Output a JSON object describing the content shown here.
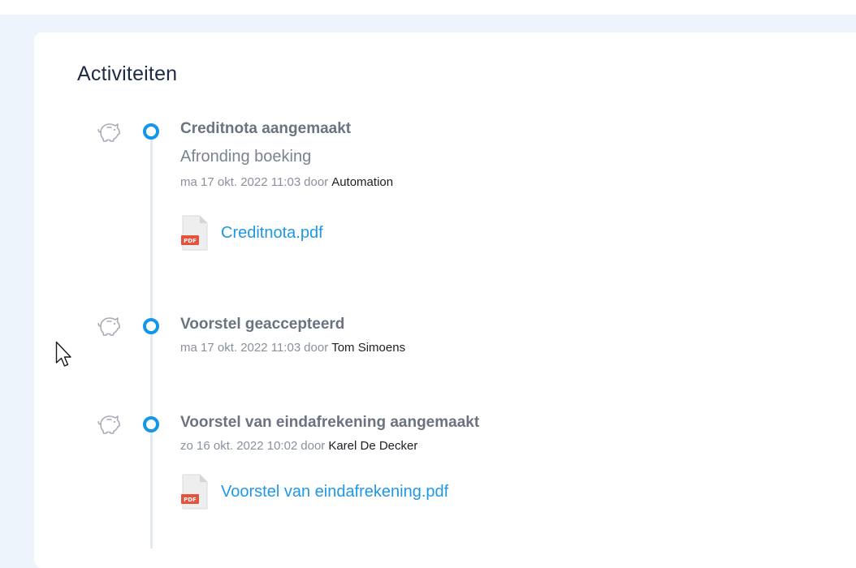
{
  "section": {
    "title": "Activiteiten"
  },
  "activities": [
    {
      "icon": "piggy-bank-icon",
      "title": "Creditnota aangemaakt",
      "description": "Afronding boeking",
      "date": "ma 17 okt. 2022 11:03",
      "by": "door",
      "author": "Automation",
      "attachment": {
        "icon": "pdf-file-icon",
        "icon_label": "PDF",
        "name": "Creditnota.pdf"
      }
    },
    {
      "icon": "piggy-bank-icon",
      "title": "Voorstel geaccepteerd",
      "date": "ma 17 okt. 2022 11:03",
      "by": "door",
      "author": "Tom Simoens"
    },
    {
      "icon": "piggy-bank-icon",
      "title": "Voorstel van eindafrekening aangemaakt",
      "date": "zo 16 okt. 2022 10:02",
      "by": "door",
      "author": "Karel De Decker",
      "attachment": {
        "icon": "pdf-file-icon",
        "icon_label": "PDF",
        "name": "Voorstel van eindafrekening.pdf"
      }
    }
  ],
  "colors": {
    "background": "#eef4fb",
    "card": "#ffffff",
    "accent": "#1597e8",
    "link": "#1e98e6",
    "pdf_badge": "#e5533d"
  }
}
